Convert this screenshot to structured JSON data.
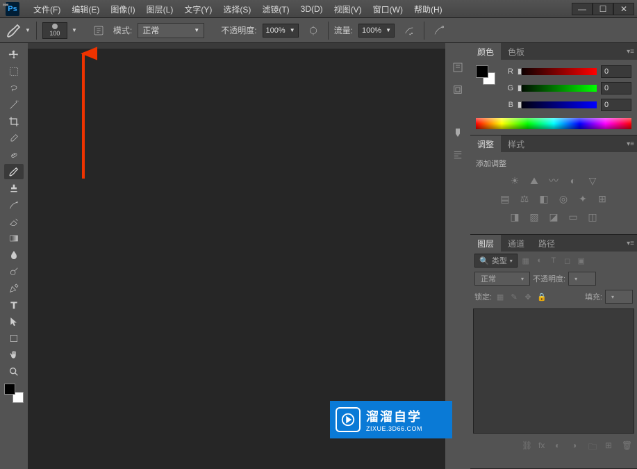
{
  "app": {
    "logo": "Ps"
  },
  "menu": [
    "文件(F)",
    "编辑(E)",
    "图像(I)",
    "图层(L)",
    "文字(Y)",
    "选择(S)",
    "滤镜(T)",
    "3D(D)",
    "视图(V)",
    "窗口(W)",
    "帮助(H)"
  ],
  "window_controls": {
    "minimize": "—",
    "maximize": "☐",
    "close": "✕"
  },
  "options": {
    "brush_size": "100",
    "mode_label": "模式:",
    "mode_value": "正常",
    "opacity_label": "不透明度:",
    "opacity_value": "100%",
    "flow_label": "流量:",
    "flow_value": "100%"
  },
  "tools": [
    "move",
    "marquee",
    "lasso",
    "wand",
    "crop",
    "eyedropper",
    "heal",
    "brush",
    "stamp",
    "history",
    "eraser",
    "gradient",
    "blur",
    "dodge",
    "pen",
    "text",
    "path-select",
    "shape",
    "hand",
    "zoom"
  ],
  "panels": {
    "color": {
      "tabs": [
        "颜色",
        "色板"
      ],
      "channels": [
        {
          "label": "R",
          "value": "0"
        },
        {
          "label": "G",
          "value": "0"
        },
        {
          "label": "B",
          "value": "0"
        }
      ]
    },
    "adjust": {
      "tabs": [
        "调整",
        "样式"
      ],
      "hint": "添加调整"
    },
    "layers": {
      "tabs": [
        "图层",
        "通道",
        "路径"
      ],
      "filter_label": "类型",
      "blend_mode": "正常",
      "opacity_label": "不透明度:",
      "lock_label": "锁定:",
      "fill_label": "填充:"
    }
  },
  "watermark": {
    "title": "溜溜自学",
    "url": "ZIXUE.3D66.COM"
  }
}
